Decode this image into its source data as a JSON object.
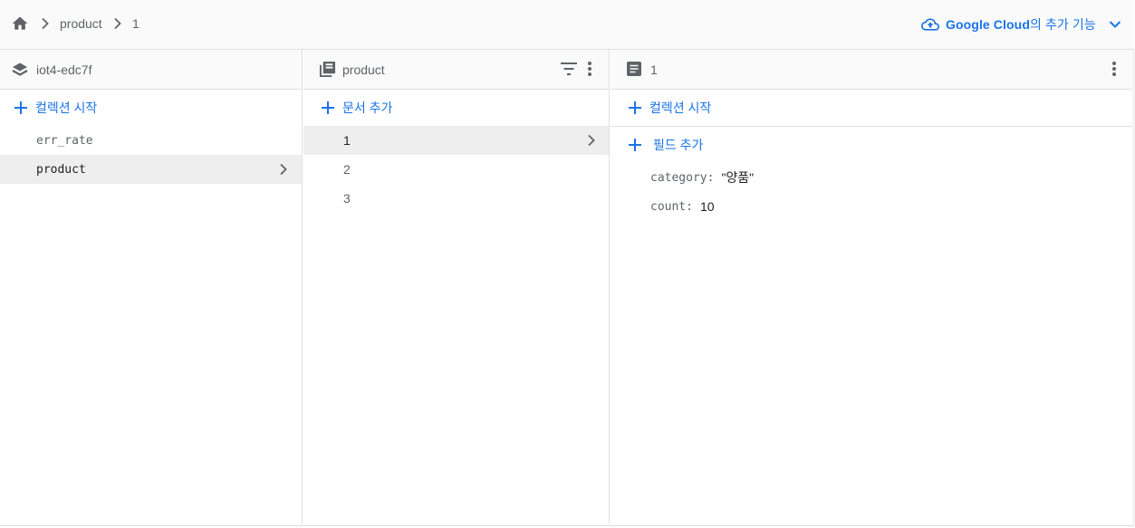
{
  "breadcrumb": {
    "items": [
      "product",
      "1"
    ]
  },
  "google_cloud": {
    "brand": "Google Cloud",
    "suffix": "의 추가 기능"
  },
  "columns": {
    "root": {
      "title": "iot4-edc7f",
      "start_collection_label": "컬렉션 시작",
      "collections": [
        "err_rate",
        "product"
      ],
      "selected": "product"
    },
    "collection": {
      "title": "product",
      "add_document_label": "문서 추가",
      "documents": [
        "1",
        "2",
        "3"
      ],
      "selected": "1"
    },
    "document": {
      "title": "1",
      "start_collection_label": "컬렉션 시작",
      "add_field_label": "필드 추가",
      "fields": [
        {
          "key": "category:",
          "value": "\"양품\""
        },
        {
          "key": "count:",
          "value": "10"
        }
      ]
    }
  },
  "colors": {
    "accent": "#1a73e8",
    "selected_row": "#eeeeee",
    "header_bg": "#fafafa",
    "border": "#e0e0e0"
  },
  "icons": {
    "home": "home-icon",
    "cloud": "cloud-upload-icon",
    "database": "database-layers-icon",
    "collection": "collection-stack-icon",
    "document": "document-icon",
    "filter": "filter-icon",
    "more": "more-vert-icon"
  }
}
